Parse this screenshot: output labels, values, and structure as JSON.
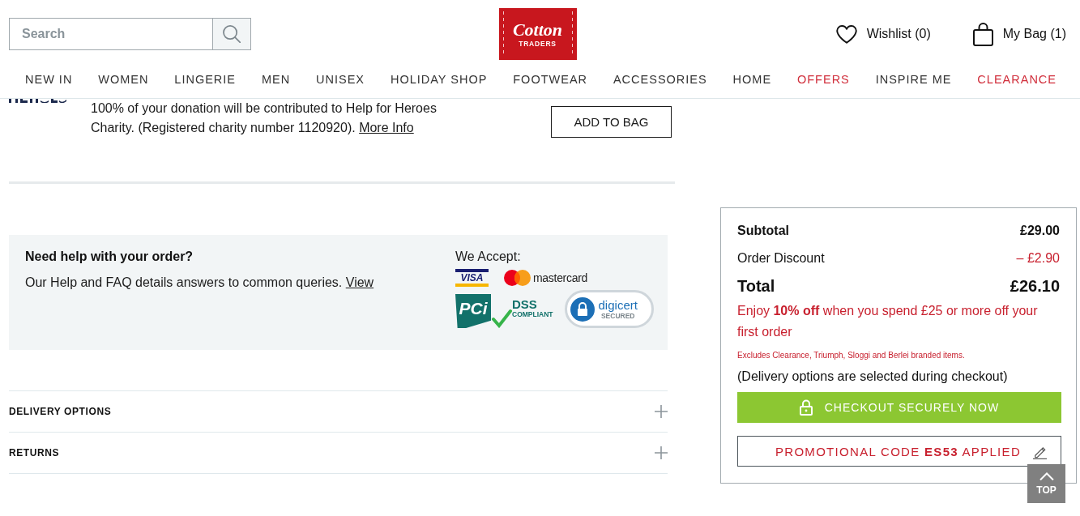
{
  "header": {
    "search": {
      "placeholder": "Search"
    },
    "logo": {
      "wordmark": "Cotton",
      "tagline": "TRADERS"
    },
    "links": [
      {
        "kind": "wishlist",
        "label": "Wishlist (0)"
      },
      {
        "kind": "bag",
        "label": "My Bag (1)"
      }
    ]
  },
  "nav": [
    {
      "label": "NEW IN",
      "color": "#333333"
    },
    {
      "label": "WOMEN",
      "color": "#333333"
    },
    {
      "label": "LINGERIE",
      "color": "#333333"
    },
    {
      "label": "MEN",
      "color": "#333333"
    },
    {
      "label": "UNISEX",
      "color": "#333333"
    },
    {
      "label": "HOLIDAY SHOP",
      "color": "#333333"
    },
    {
      "label": "FOOTWEAR",
      "color": "#333333"
    },
    {
      "label": "ACCESSORIES",
      "color": "#333333"
    },
    {
      "label": "HOME",
      "color": "#333333"
    },
    {
      "label": "OFFERS",
      "color": "#d12f3c"
    },
    {
      "label": "INSPIRE ME",
      "color": "#333333"
    },
    {
      "label": "CLEARANCE",
      "color": "#d12f3c"
    }
  ],
  "donation": {
    "text": "100% of your donation will be contributed to Help for Heroes Charity. (Registered charity number 1120920).",
    "link": "More Info",
    "button": "ADD TO BAG"
  },
  "help": {
    "title": "Need help with your order?",
    "text": "Our Help and FAQ details answers to common queries.",
    "link": "View",
    "accept_label": "We Accept:",
    "payment_logos": [
      {
        "kind": "visa",
        "name": "VISA"
      },
      {
        "kind": "mastercard",
        "name": "mastercard"
      },
      {
        "kind": "pci",
        "name": "PCi",
        "sub": "DSS",
        "note": "COMPLIANT"
      },
      {
        "kind": "digicert",
        "name": "digicert",
        "note": "SECURED"
      }
    ]
  },
  "accordion": [
    {
      "label": "DELIVERY OPTIONS",
      "expanded": false
    },
    {
      "label": "RETURNS",
      "expanded": false
    }
  ],
  "summary": {
    "rows": [
      {
        "kind": "subtotal",
        "label": "Subtotal",
        "value": "£29.00"
      },
      {
        "kind": "discount",
        "label": "Order Discount",
        "value": "– £2.90"
      },
      {
        "kind": "total",
        "label": "Total",
        "value": "£26.10"
      }
    ],
    "offer": "Enjoy **10% off** when you spend £25 or more off your first order",
    "exclusions": "Excludes Clearance, Triumph, Sloggi and Berlei branded items.",
    "delivery_note": "(Delivery options are selected during checkout)",
    "checkout_button": "CHECKOUT SECURELY NOW",
    "promo_button": "PROMOTIONAL CODE **ES53** APPLIED"
  },
  "back_to_top": "TOP"
}
